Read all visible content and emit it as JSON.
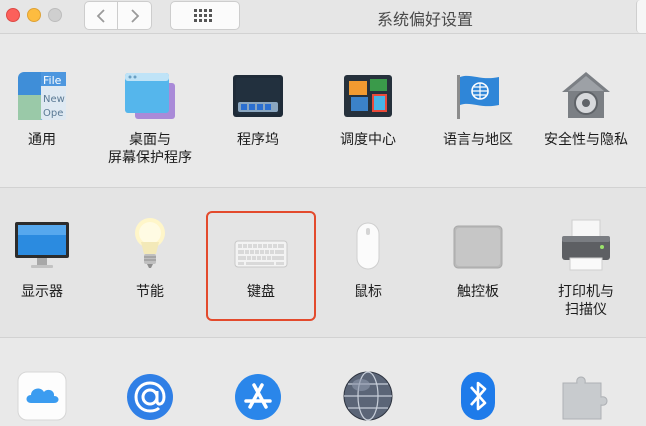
{
  "window": {
    "title": "系统偏好设置"
  },
  "icons": {
    "back": "chevron-left-icon",
    "forward": "chevron-right-icon",
    "show_all": "grid-icon"
  },
  "row1": [
    {
      "label": "通用",
      "icon": "general-icon"
    },
    {
      "label": "桌面与\n屏幕保护程序",
      "icon": "desktop-screensaver-icon"
    },
    {
      "label": "程序坞",
      "icon": "dock-icon"
    },
    {
      "label": "调度中心",
      "icon": "mission-control-icon"
    },
    {
      "label": "语言与地区",
      "icon": "language-region-icon"
    },
    {
      "label": "安全性与隐私",
      "icon": "security-privacy-icon"
    }
  ],
  "row2": [
    {
      "label": "显示器",
      "icon": "displays-icon"
    },
    {
      "label": "节能",
      "icon": "energy-saver-icon"
    },
    {
      "label": "键盘",
      "icon": "keyboard-icon",
      "highlighted": true
    },
    {
      "label": "鼠标",
      "icon": "mouse-icon"
    },
    {
      "label": "触控板",
      "icon": "trackpad-icon"
    },
    {
      "label": "打印机与\n扫描仪",
      "icon": "printers-scanners-icon"
    }
  ],
  "row3": [
    {
      "icon": "icloud-icon"
    },
    {
      "icon": "internet-accounts-icon"
    },
    {
      "icon": "app-store-icon"
    },
    {
      "icon": "network-icon"
    },
    {
      "icon": "bluetooth-icon"
    },
    {
      "icon": "extensions-icon"
    }
  ],
  "general_icon_text": [
    "File",
    "New",
    "Ope"
  ],
  "colors": {
    "highlight": "#e34a2c"
  }
}
